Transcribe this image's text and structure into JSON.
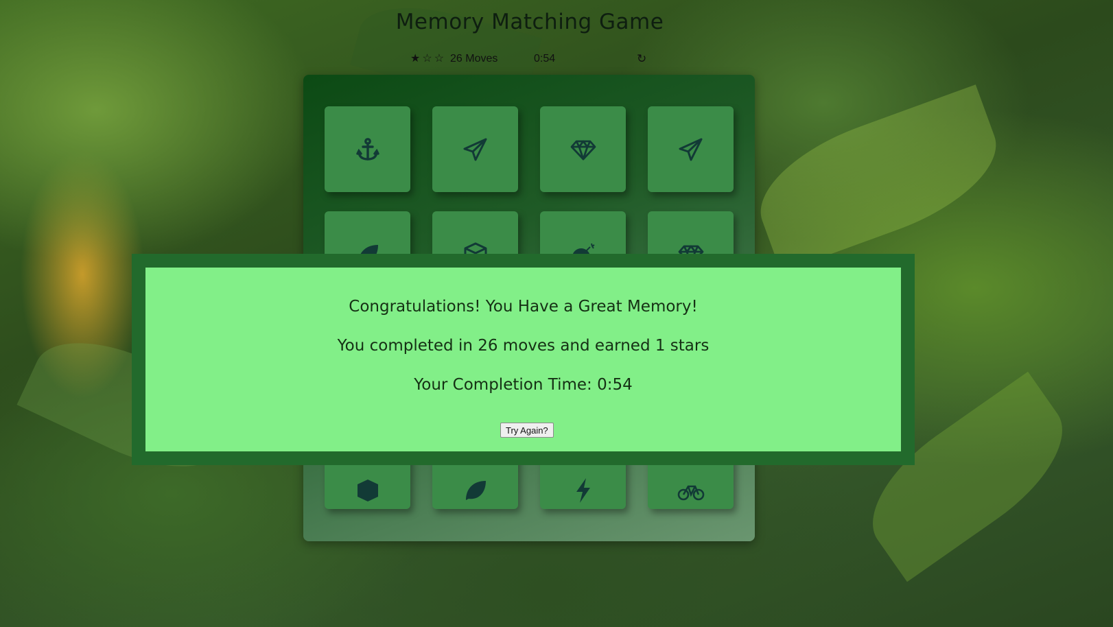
{
  "title": "Memory Matching Game",
  "score_panel": {
    "stars": [
      "★",
      "☆",
      "☆"
    ],
    "moves_label": "26 Moves",
    "timer": "0:54",
    "restart_glyph": "↻"
  },
  "deck": {
    "cards": [
      {
        "icon": "anchor-icon"
      },
      {
        "icon": "paper-plane-icon"
      },
      {
        "icon": "diamond-icon"
      },
      {
        "icon": "paper-plane-icon"
      },
      {
        "icon": "leaf-icon"
      },
      {
        "icon": "cube-icon"
      },
      {
        "icon": "bomb-icon"
      },
      {
        "icon": "diamond-icon"
      },
      {
        "icon": "cube-icon"
      },
      {
        "icon": "leaf-icon"
      },
      {
        "icon": "bolt-icon"
      },
      {
        "icon": "bicycle-icon"
      }
    ]
  },
  "modal": {
    "congrats": "Congratulations! You Have a Great Memory!",
    "summary": "You completed in 26 moves and earned 1 stars",
    "completion_time": "Your Completion Time: 0:54",
    "try_again_label": "Try Again?"
  },
  "colors": {
    "modal_frame": "#226a2c",
    "modal_body": "#82ef88",
    "card": "#3b8c48",
    "icon": "#123a36"
  }
}
